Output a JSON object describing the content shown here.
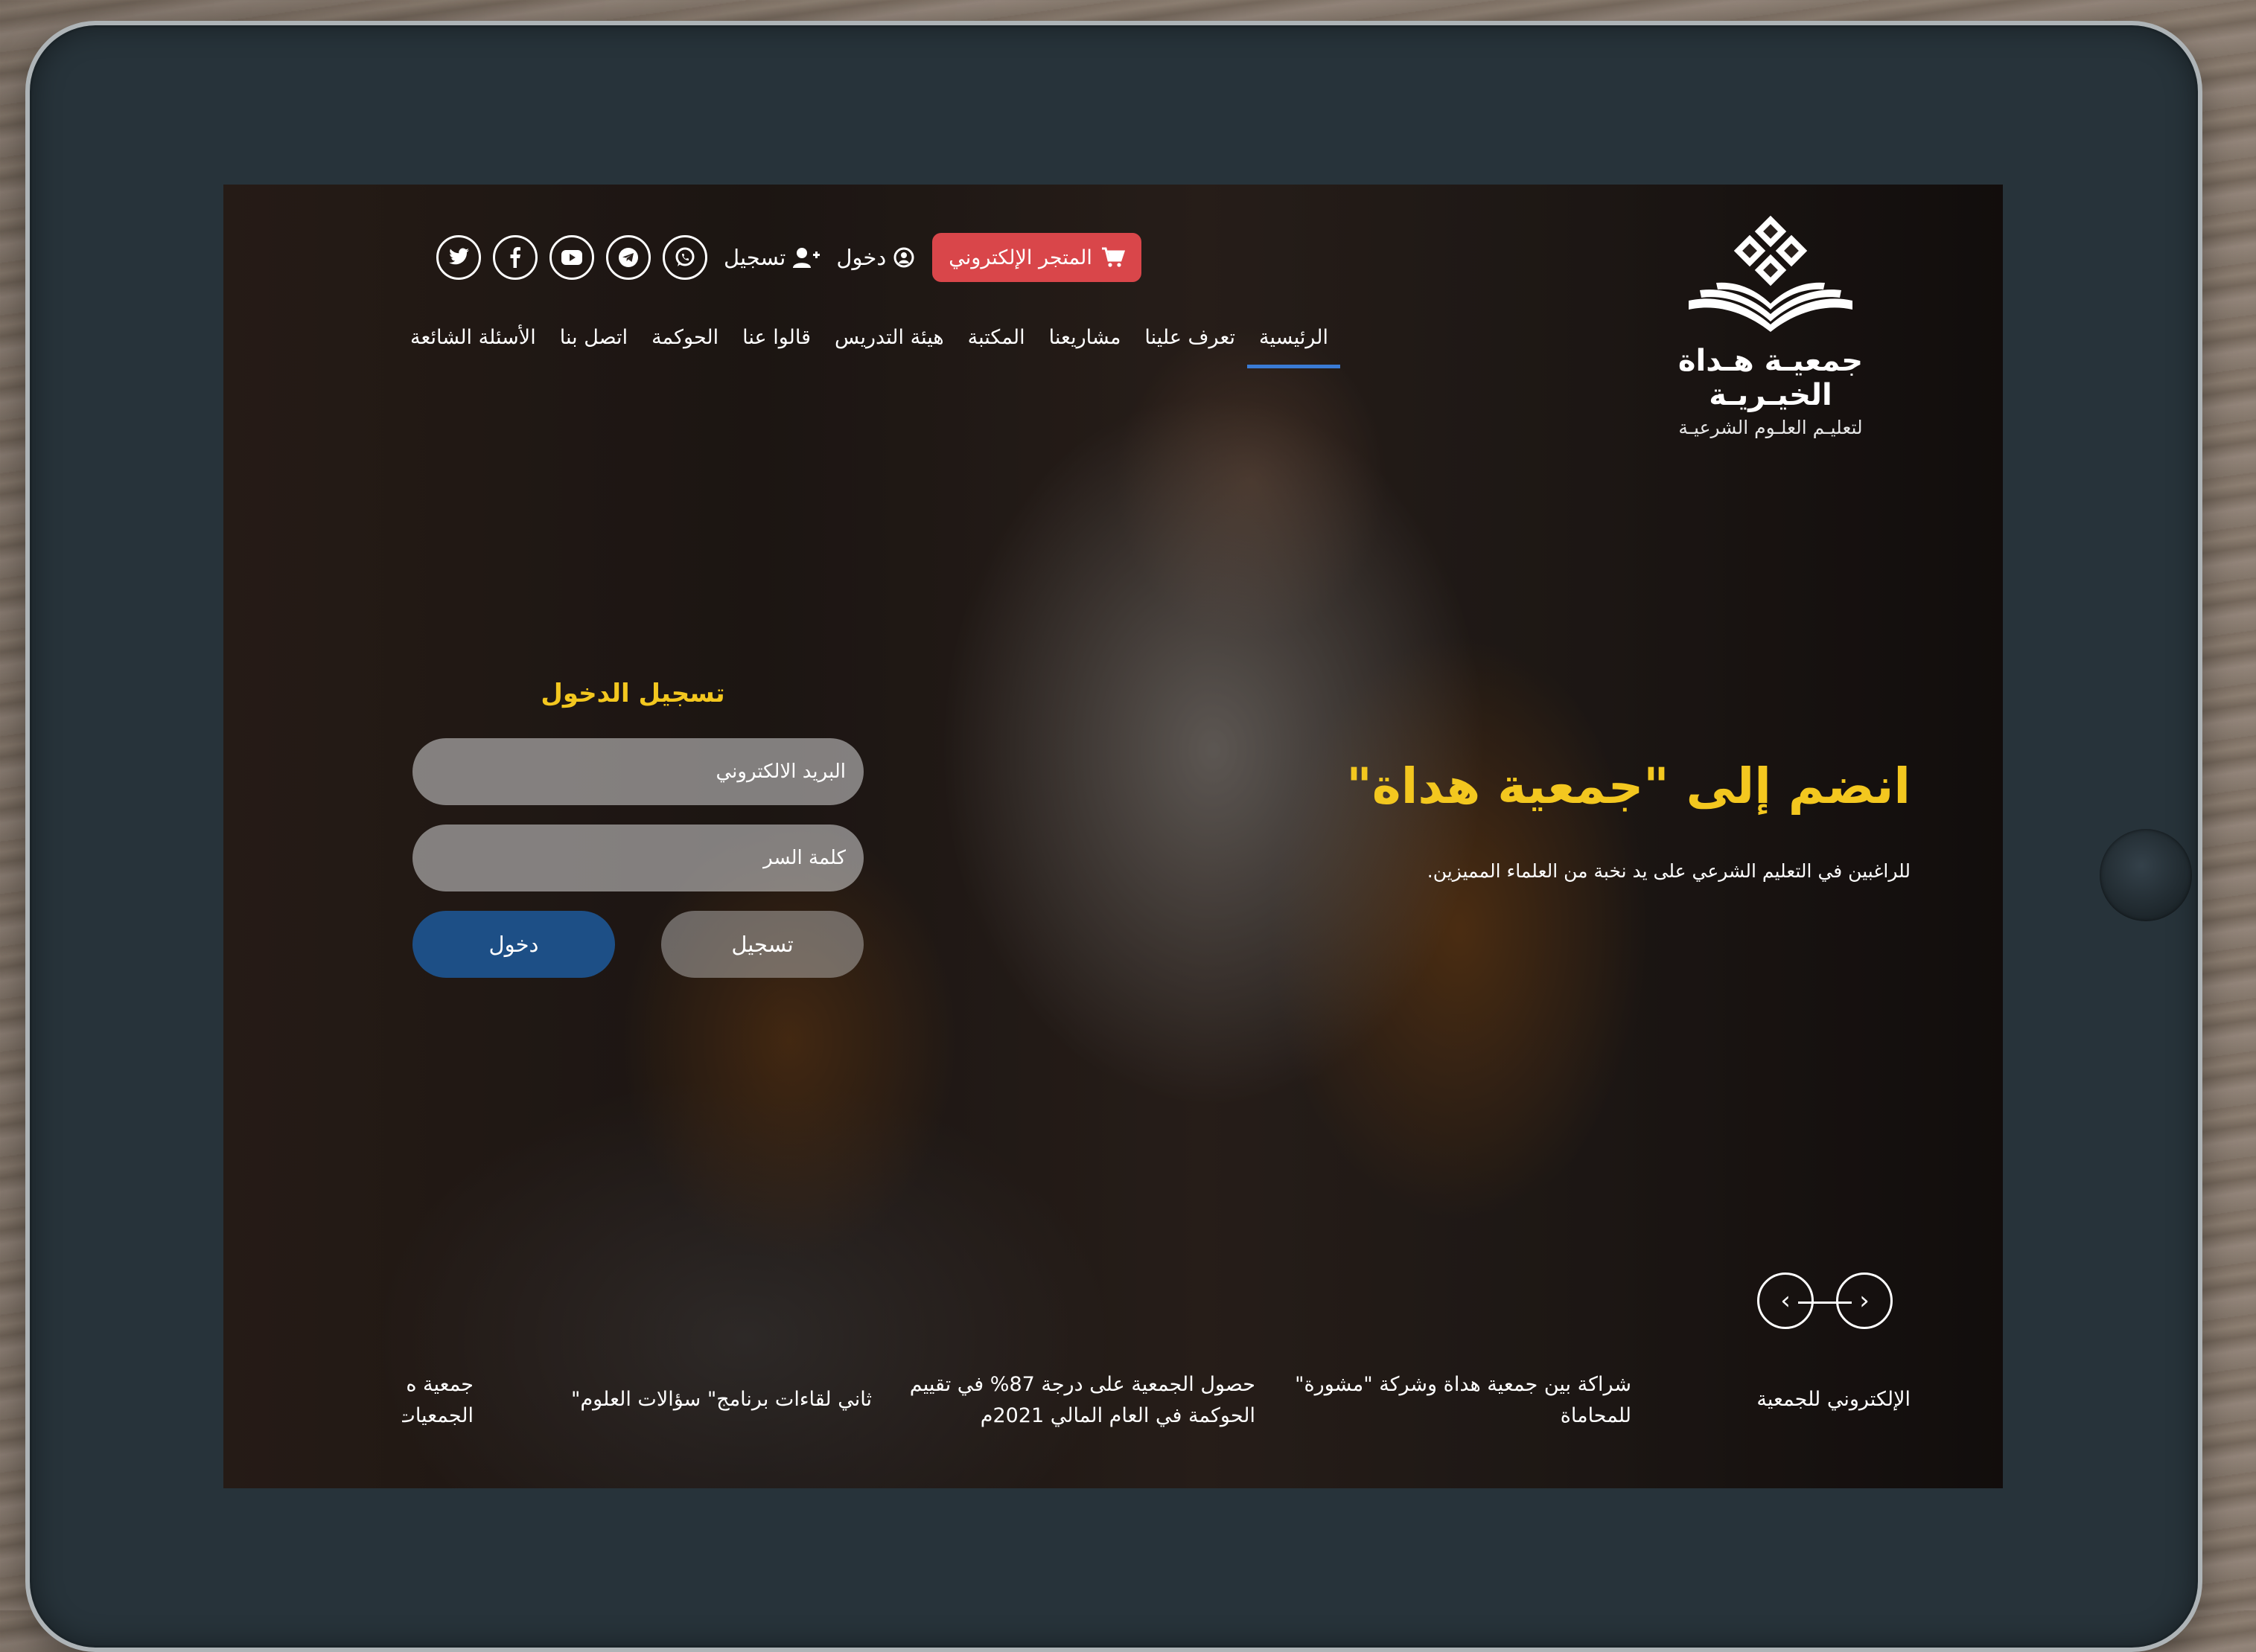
{
  "header": {
    "logo": {
      "title": "جمعيـة هـداة الخيـريـة",
      "subtitle": "لتعليـم العلـوم الشرعيـة"
    },
    "store_button": {
      "label": "المتجر الإلكتروني",
      "icon": "cart-icon",
      "color": "#d9464a"
    },
    "login_link": {
      "label": "دخول",
      "icon": "user-circle-icon"
    },
    "register_link": {
      "label": "تسجيل",
      "icon": "user-plus-icon"
    },
    "social_icons": [
      "twitter-icon",
      "facebook-icon",
      "youtube-icon",
      "telegram-icon",
      "whatsapp-icon"
    ]
  },
  "nav": {
    "items": [
      {
        "label": "الرئيسية",
        "active": true
      },
      {
        "label": "تعرف علينا"
      },
      {
        "label": "مشاريعنا"
      },
      {
        "label": "المكتبة"
      },
      {
        "label": "هيئة التدريس"
      },
      {
        "label": "قالوا عنا"
      },
      {
        "label": "الحوكمة"
      },
      {
        "label": "اتصل بنا"
      },
      {
        "label": "الأسئلة الشائعة"
      }
    ],
    "active_color": "#3a7bd5"
  },
  "hero": {
    "title": "انضم إلى \"جمعية هداة\"",
    "subtitle": "للراغبين في التعليم الشرعي على يد نخبة من العلماء المميزين.",
    "accent_color": "#f3c71f"
  },
  "login": {
    "title": "تسجيل الدخول",
    "email_placeholder": "البريد الالكتروني",
    "password_placeholder": "كلمة السر",
    "register_label": "تسجيل",
    "login_label": "دخول",
    "login_color": "#1d4f86"
  },
  "news": [
    {
      "line1": "الإلكتروني للجمعية",
      "line2": ""
    },
    {
      "line1": "شراكة بين جمعية هداة وشركة \"مشورة\"",
      "line2": "للمحاماة"
    },
    {
      "line1": "حصول الجمعية على درجة 87% في تقييم",
      "line2": "الحوكمة في العام المالي 2021م"
    },
    {
      "line1": "ثاني لقاءات برنامج\" سؤالات العلوم\"",
      "line2": ""
    },
    {
      "line1": "جمعية ه",
      "line2": "الجمعيات"
    }
  ]
}
